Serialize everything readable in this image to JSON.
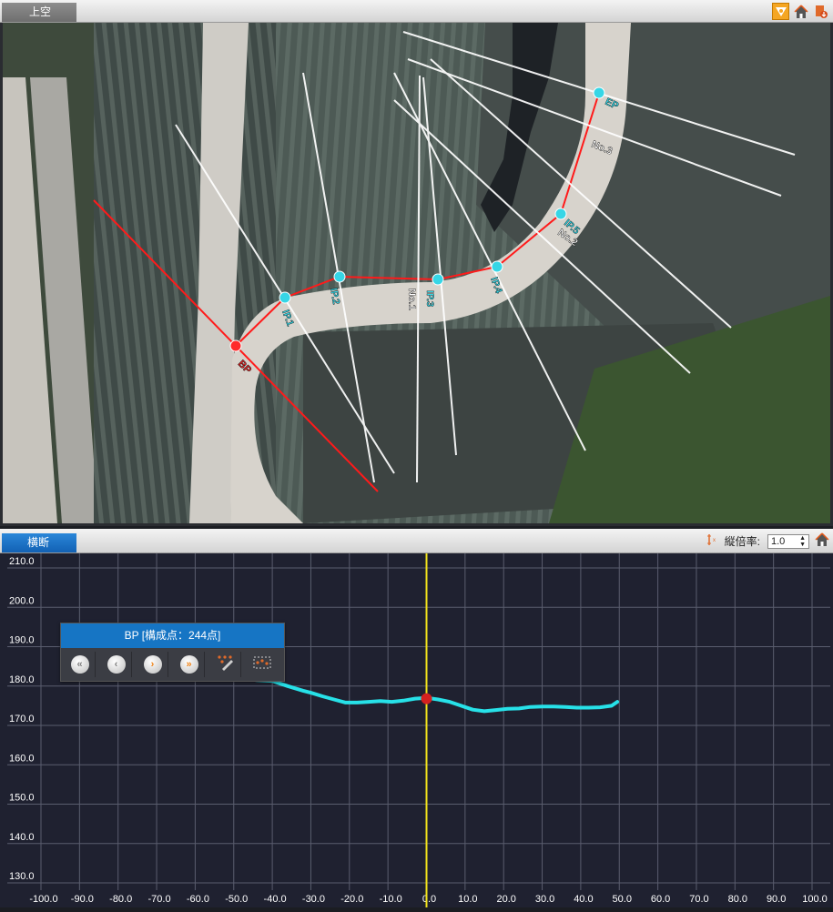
{
  "top_panel": {
    "tab_label": "上空",
    "tool_icons": [
      "measure-icon",
      "home-icon",
      "export-icon"
    ],
    "map_labels": [
      "BP",
      "IP.1",
      "IP.2",
      "No.1",
      "IP.3",
      "IP.4",
      "No.2",
      "IP.5",
      "No.3",
      "EP"
    ]
  },
  "bottom_panel": {
    "tab_label": "横断",
    "scale_label": "縦倍率:",
    "scale_value": "1.0"
  },
  "overlay": {
    "title": "BP [構成点：244点]",
    "buttons": [
      "first-icon",
      "prev-icon",
      "next-icon",
      "last-icon",
      "edit-points-icon",
      "select-points-icon"
    ]
  },
  "colors": {
    "accent": "#1675c4",
    "alignment": "#ff1a1a",
    "profile": "#27e1e8",
    "centerline": "#f2e21c",
    "grid_bg": "#1f2130"
  },
  "chart_data": {
    "type": "line",
    "title": "",
    "xlabel": "",
    "ylabel": "",
    "xlim": [
      -100,
      100
    ],
    "ylim": [
      130,
      210
    ],
    "x_ticks": [
      "-100.0",
      "-90.0",
      "-80.0",
      "-70.0",
      "-60.0",
      "-50.0",
      "-40.0",
      "-30.0",
      "-20.0",
      "-10.0",
      "0.0",
      "10.0",
      "20.0",
      "30.0",
      "40.0",
      "50.0",
      "60.0",
      "70.0",
      "80.0",
      "90.0",
      "100.0"
    ],
    "y_ticks": [
      "130.0",
      "140.0",
      "150.0",
      "160.0",
      "170.0",
      "180.0",
      "190.0",
      "200.0",
      "210.0"
    ],
    "grid": true,
    "series": [
      {
        "x": [
          -60,
          -56,
          -52,
          -48,
          -44,
          -40,
          -36,
          -32,
          -30,
          -27,
          -24,
          -21,
          -18,
          -15,
          -12,
          -9,
          -6,
          -3,
          0,
          3,
          6,
          9,
          12,
          15,
          18,
          21,
          24,
          27,
          30,
          33,
          36,
          39,
          42,
          45,
          48,
          49.5
        ],
        "y": [
          183.4,
          183.0,
          182.5,
          182.0,
          181.5,
          181.3,
          180.0,
          178.8,
          178.3,
          177.4,
          176.6,
          175.8,
          175.8,
          176.0,
          176.2,
          176.0,
          176.3,
          176.8,
          177.0,
          176.6,
          176.0,
          175.0,
          174.0,
          173.6,
          173.9,
          174.2,
          174.3,
          174.7,
          174.8,
          174.8,
          174.7,
          174.5,
          174.5,
          174.6,
          175.0,
          176.0
        ]
      }
    ],
    "marker": {
      "x": 0,
      "y": 176.8
    }
  }
}
